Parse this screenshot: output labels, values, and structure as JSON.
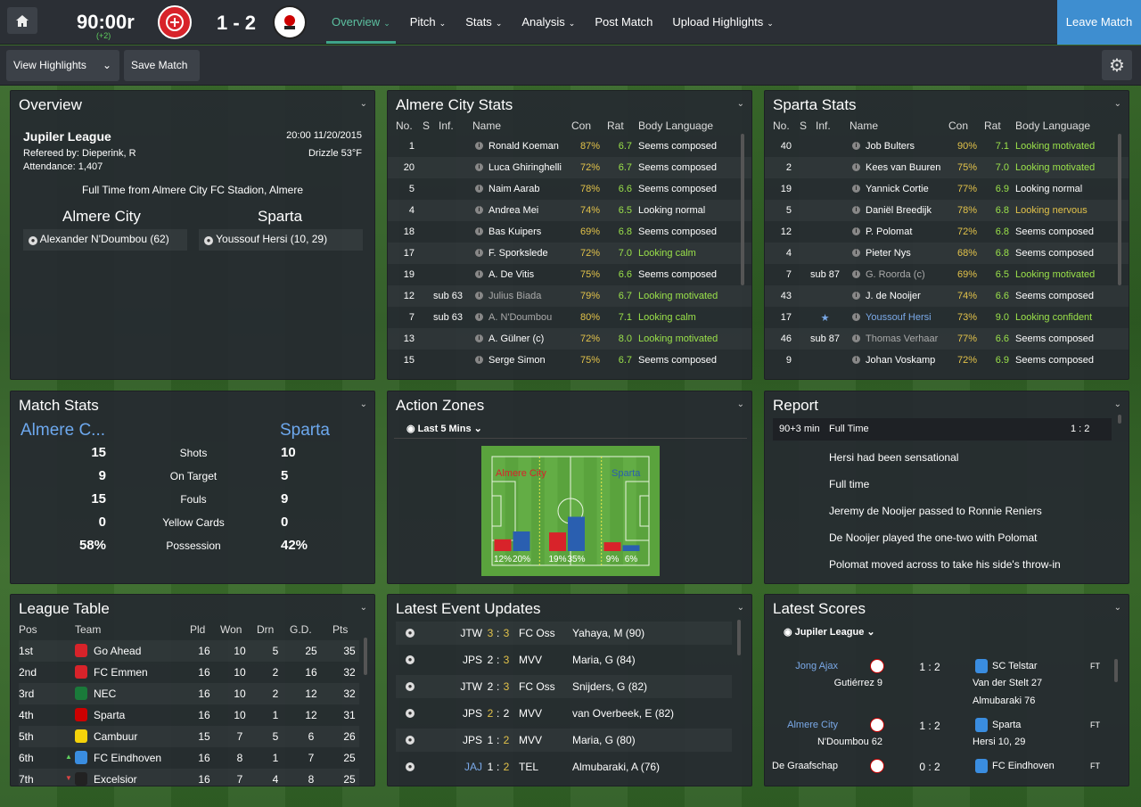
{
  "topbar": {
    "clock": "90:00r",
    "added": "(+2)",
    "score": "1 - 2",
    "home_crest": "ALMERE",
    "away_crest": "SPARTA",
    "nav": [
      "Overview",
      "Pitch",
      "Stats",
      "Analysis",
      "Post Match",
      "Upload Highlights"
    ],
    "leave": "Leave Match"
  },
  "subbar": {
    "view_highlights": "View Highlights",
    "save_match": "Save Match"
  },
  "overview": {
    "title": "Overview",
    "league": "Jupiler League",
    "datetime": "20:00 11/20/2015",
    "referee": "Refereed by: Dieperink, R",
    "weather": "Drizzle 53°F",
    "attendance": "Attendance: 1,407",
    "fulltime": "Full Time from Almere City FC Stadion, Almere",
    "home": "Almere City",
    "away": "Sparta",
    "home_scorer": "Alexander N'Doumbou (62)",
    "away_scorer": "Youssouf Hersi (10, 29)"
  },
  "almere_stats": {
    "title": "Almere City Stats",
    "headers": [
      "No.",
      "S",
      "Inf.",
      "Name",
      "Con",
      "Rat",
      "Body Language"
    ],
    "rows": [
      {
        "no": "1",
        "sub": "",
        "name": "Ronald Koeman",
        "con": "87%",
        "rat": "6.7",
        "body": "Seems composed",
        "bc": "w",
        "nc": "w"
      },
      {
        "no": "20",
        "sub": "",
        "name": "Luca Ghiringhelli",
        "con": "72%",
        "rat": "6.7",
        "body": "Seems composed",
        "bc": "w",
        "nc": "w"
      },
      {
        "no": "5",
        "sub": "",
        "name": "Naim Aarab",
        "con": "78%",
        "rat": "6.6",
        "body": "Seems composed",
        "bc": "w",
        "nc": "w"
      },
      {
        "no": "4",
        "sub": "",
        "name": "Andrea Mei",
        "con": "74%",
        "rat": "6.5",
        "body": "Looking normal",
        "bc": "w",
        "nc": "w"
      },
      {
        "no": "18",
        "sub": "",
        "name": "Bas Kuipers",
        "con": "69%",
        "rat": "6.8",
        "body": "Seems composed",
        "bc": "w",
        "nc": "w"
      },
      {
        "no": "17",
        "sub": "",
        "name": "F. Sporkslede",
        "con": "72%",
        "rat": "7.0",
        "body": "Looking calm",
        "bc": "g",
        "nc": "w"
      },
      {
        "no": "19",
        "sub": "",
        "name": "A. De Vitis",
        "con": "75%",
        "rat": "6.6",
        "body": "Seems composed",
        "bc": "w",
        "nc": "w"
      },
      {
        "no": "12",
        "sub": "sub 63",
        "name": "Julius Biada",
        "con": "79%",
        "rat": "6.7",
        "body": "Looking motivated",
        "bc": "g",
        "nc": "gr"
      },
      {
        "no": "7",
        "sub": "sub 63",
        "name": "A. N'Doumbou",
        "con": "80%",
        "rat": "7.1",
        "body": "Looking calm",
        "bc": "g",
        "nc": "gr"
      },
      {
        "no": "13",
        "sub": "",
        "name": "A. Gülner (c)",
        "con": "72%",
        "rat": "8.0",
        "body": "Looking motivated",
        "bc": "g",
        "nc": "w"
      },
      {
        "no": "15",
        "sub": "",
        "name": "Serge Simon",
        "con": "75%",
        "rat": "6.7",
        "body": "Seems composed",
        "bc": "w",
        "nc": "w"
      }
    ]
  },
  "sparta_stats": {
    "title": "Sparta Stats",
    "headers": [
      "No.",
      "S",
      "Inf.",
      "Name",
      "Con",
      "Rat",
      "Body Language"
    ],
    "rows": [
      {
        "no": "40",
        "sub": "",
        "name": "Job Bulters",
        "con": "90%",
        "rat": "7.1",
        "body": "Looking motivated",
        "bc": "g",
        "nc": "w"
      },
      {
        "no": "2",
        "sub": "",
        "name": "Kees van Buuren",
        "con": "75%",
        "rat": "7.0",
        "body": "Looking motivated",
        "bc": "g",
        "nc": "w"
      },
      {
        "no": "19",
        "sub": "",
        "name": "Yannick Cortie",
        "con": "77%",
        "rat": "6.9",
        "body": "Looking normal",
        "bc": "w",
        "nc": "w"
      },
      {
        "no": "5",
        "sub": "",
        "name": "Daniël Breedijk",
        "con": "78%",
        "rat": "6.8",
        "body": "Looking nervous",
        "bc": "y",
        "nc": "w"
      },
      {
        "no": "12",
        "sub": "",
        "name": "P. Polomat",
        "con": "72%",
        "rat": "6.8",
        "body": "Seems composed",
        "bc": "w",
        "nc": "w"
      },
      {
        "no": "4",
        "sub": "",
        "name": "Pieter Nys",
        "con": "68%",
        "rat": "6.8",
        "body": "Seems composed",
        "bc": "w",
        "nc": "w"
      },
      {
        "no": "7",
        "sub": "sub 87",
        "name": "G. Roorda (c)",
        "con": "69%",
        "rat": "6.5",
        "body": "Looking motivated",
        "bc": "g",
        "nc": "gr"
      },
      {
        "no": "43",
        "sub": "",
        "name": "J. de Nooijer",
        "con": "74%",
        "rat": "6.6",
        "body": "Seems composed",
        "bc": "w",
        "nc": "w"
      },
      {
        "no": "17",
        "sub": "★",
        "name": "Youssouf Hersi",
        "con": "73%",
        "rat": "9.0",
        "body": "Looking confident",
        "bc": "g",
        "nc": "bl"
      },
      {
        "no": "46",
        "sub": "sub 87",
        "name": "Thomas Verhaar",
        "con": "77%",
        "rat": "6.6",
        "body": "Seems composed",
        "bc": "w",
        "nc": "gr"
      },
      {
        "no": "9",
        "sub": "",
        "name": "Johan Voskamp",
        "con": "72%",
        "rat": "6.9",
        "body": "Seems composed",
        "bc": "w",
        "nc": "w"
      }
    ]
  },
  "match_stats": {
    "title": "Match Stats",
    "home": "Almere C...",
    "away": "Sparta",
    "rows": [
      {
        "h": "15",
        "l": "Shots",
        "a": "10"
      },
      {
        "h": "9",
        "l": "On Target",
        "a": "5"
      },
      {
        "h": "15",
        "l": "Fouls",
        "a": "9"
      },
      {
        "h": "0",
        "l": "Yellow Cards",
        "a": "0"
      },
      {
        "h": "58%",
        "l": "Possession",
        "a": "42%"
      }
    ]
  },
  "action_zones": {
    "title": "Action Zones",
    "filter": "Last 5 Mins",
    "home": "Almere City",
    "away": "Sparta",
    "zones": [
      {
        "home": 12,
        "away": 20,
        "home_label": "12%",
        "away_label": "20%"
      },
      {
        "home": 19,
        "away": 35,
        "home_label": "19%",
        "away_label": "35%"
      },
      {
        "home": 9,
        "away": 6,
        "home_label": "9%",
        "away_label": "6%"
      }
    ]
  },
  "report": {
    "title": "Report",
    "minute": "90+3 min",
    "state": "Full Time",
    "score": "1 : 2",
    "lines": [
      "Hersi had been sensational",
      "Full time",
      "Jeremy de Nooijer passed to Ronnie Reniers",
      "De Nooijer played the one-two with Polomat",
      "Polomat moved across to take his side's throw-in"
    ]
  },
  "league_table": {
    "title": "League Table",
    "headers": [
      "Pos",
      "Team",
      "Pld",
      "Won",
      "Drn",
      "G.D.",
      "Pts"
    ],
    "rows": [
      {
        "pos": "1st",
        "team": "Go Ahead",
        "pld": "16",
        "won": "10",
        "drn": "5",
        "gd": "25",
        "pts": "35",
        "arrow": ""
      },
      {
        "pos": "2nd",
        "team": "FC Emmen",
        "pld": "16",
        "won": "10",
        "drn": "2",
        "gd": "16",
        "pts": "32",
        "arrow": ""
      },
      {
        "pos": "3rd",
        "team": "NEC",
        "pld": "16",
        "won": "10",
        "drn": "2",
        "gd": "12",
        "pts": "32",
        "arrow": ""
      },
      {
        "pos": "4th",
        "team": "Sparta",
        "pld": "16",
        "won": "10",
        "drn": "1",
        "gd": "12",
        "pts": "31",
        "arrow": ""
      },
      {
        "pos": "5th",
        "team": "Cambuur",
        "pld": "15",
        "won": "7",
        "drn": "5",
        "gd": "6",
        "pts": "26",
        "arrow": ""
      },
      {
        "pos": "6th",
        "team": "FC Eindhoven",
        "pld": "16",
        "won": "8",
        "drn": "1",
        "gd": "7",
        "pts": "25",
        "arrow": "▲"
      },
      {
        "pos": "7th",
        "team": "Excelsior",
        "pld": "16",
        "won": "7",
        "drn": "4",
        "gd": "8",
        "pts": "25",
        "arrow": "▼"
      }
    ]
  },
  "latest_events": {
    "title": "Latest Event Updates",
    "rows": [
      {
        "home": "JTW",
        "hs": "3",
        "as": "3",
        "away": "FC Oss",
        "scorer": "Yahaya, M (90)",
        "hy": true,
        "ay": true,
        "hb": false
      },
      {
        "home": "JPS",
        "hs": "2",
        "as": "3",
        "away": "MVV",
        "scorer": "Maria, G (84)",
        "hy": false,
        "ay": true,
        "hb": false
      },
      {
        "home": "JTW",
        "hs": "2",
        "as": "3",
        "away": "FC Oss",
        "scorer": "Snijders, G (82)",
        "hy": false,
        "ay": true,
        "hb": false
      },
      {
        "home": "JPS",
        "hs": "2",
        "as": "2",
        "away": "MVV",
        "scorer": "van Overbeek, E (82)",
        "hy": true,
        "ay": false,
        "hb": false
      },
      {
        "home": "JPS",
        "hs": "1",
        "as": "2",
        "away": "MVV",
        "scorer": "Maria, G (80)",
        "hy": false,
        "ay": true,
        "hb": false
      },
      {
        "home": "JAJ",
        "hs": "1",
        "as": "2",
        "away": "TEL",
        "scorer": "Almubaraki, A (76)",
        "hy": false,
        "ay": true,
        "hb": true
      }
    ]
  },
  "latest_scores": {
    "title": "Latest Scores",
    "filter": "Jupiler League",
    "matches": [
      {
        "home": "Jong Ajax",
        "away": "SC Telstar",
        "score": "1 : 2",
        "status": "FT",
        "home_scorers": "Gutiérrez 9",
        "away_scorers": "Van der Stelt 27",
        "away_scorers2": "Almubaraki 76"
      },
      {
        "home": "Almere City",
        "away": "Sparta",
        "score": "1 : 2",
        "status": "FT",
        "home_scorers": "N'Doumbou 62",
        "away_scorers": "Hersi 10, 29",
        "away_scorers2": ""
      },
      {
        "home": "De Graafschap",
        "away": "FC Eindhoven",
        "score": "0 : 2",
        "status": "FT",
        "home_scorers": "",
        "away_scorers": "",
        "away_scorers2": ""
      }
    ]
  },
  "colors": {
    "home_bar": "#d8232a",
    "away_bar": "#2a5fb0",
    "accent": "#3e8ed0",
    "positive": "#9be24a",
    "warning": "#e2c24a"
  }
}
